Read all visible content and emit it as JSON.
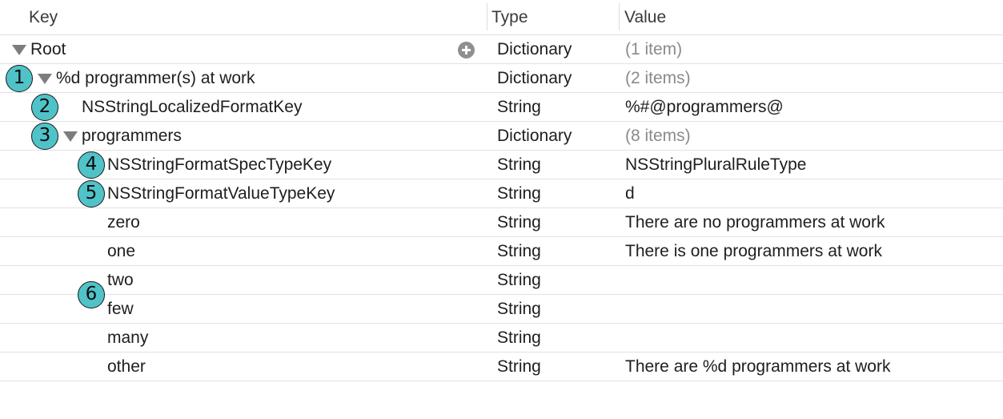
{
  "columns": {
    "key": "Key",
    "type": "Type",
    "value": "Value"
  },
  "icons": {
    "disclosure": "disclosure-triangle-icon",
    "add": "add-item-icon"
  },
  "colors": {
    "badge": "#4fc3c8",
    "muted_value": "#8a8a8a"
  },
  "rows": [
    {
      "key": "Root",
      "type": "Dictionary",
      "value": "(1 item)"
    },
    {
      "key": "%d programmer(s) at work",
      "type": "Dictionary",
      "value": "(2 items)"
    },
    {
      "key": "NSStringLocalizedFormatKey",
      "type": "String",
      "value": "%#@programmers@"
    },
    {
      "key": "programmers",
      "type": "Dictionary",
      "value": "(8 items)"
    },
    {
      "key": "NSStringFormatSpecTypeKey",
      "type": "String",
      "value": "NSStringPluralRuleType"
    },
    {
      "key": "NSStringFormatValueTypeKey",
      "type": "String",
      "value": "d"
    },
    {
      "key": "zero",
      "type": "String",
      "value": "There are no programmers at work"
    },
    {
      "key": "one",
      "type": "String",
      "value": "There is one programmers at work"
    },
    {
      "key": "two",
      "type": "String",
      "value": ""
    },
    {
      "key": "few",
      "type": "String",
      "value": ""
    },
    {
      "key": "many",
      "type": "String",
      "value": ""
    },
    {
      "key": "other",
      "type": "String",
      "value": "There are %d programmers at work"
    }
  ],
  "badges": [
    "1",
    "2",
    "3",
    "4",
    "5",
    "6"
  ]
}
